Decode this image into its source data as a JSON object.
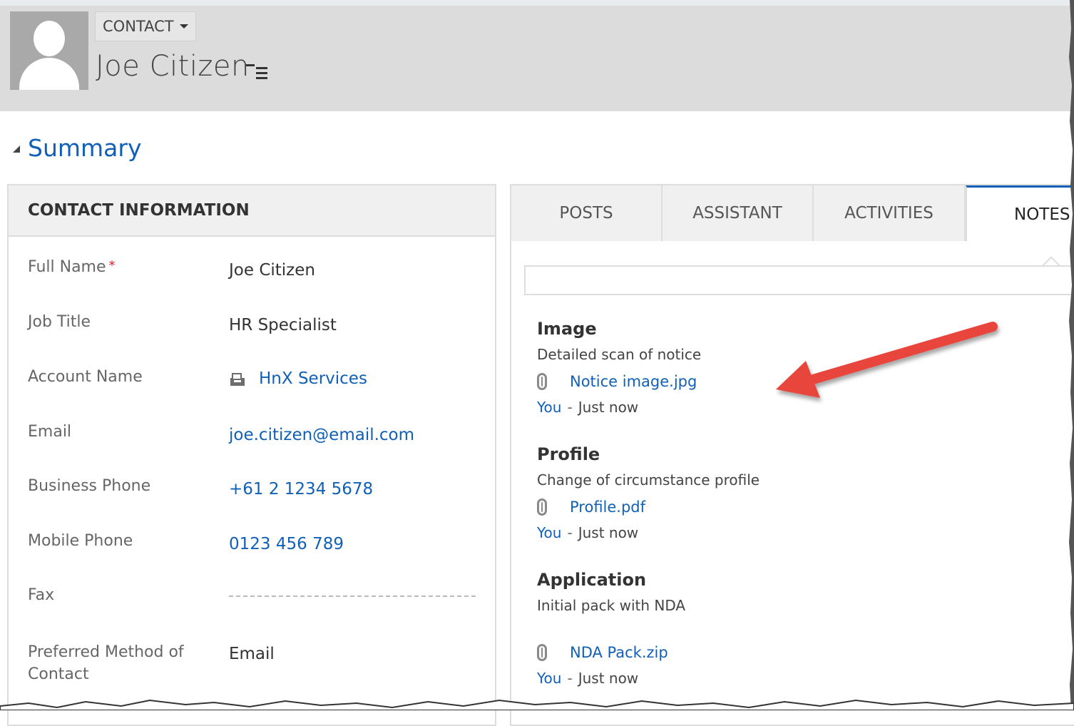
{
  "header": {
    "entity_label": "CONTACT",
    "record_name": "Joe Citizen"
  },
  "section": {
    "title": "Summary"
  },
  "contact_info": {
    "title": "CONTACT INFORMATION",
    "required_mark": "*",
    "fields": {
      "full_name": {
        "label": "Full Name",
        "value": "Joe Citizen"
      },
      "job_title": {
        "label": "Job Title",
        "value": "HR Specialist"
      },
      "account_name": {
        "label": "Account Name",
        "value": "HnX Services"
      },
      "email": {
        "label": "Email",
        "value": "joe.citizen@email.com"
      },
      "business_phone": {
        "label": "Business Phone",
        "value": "+61 2 1234 5678"
      },
      "mobile_phone": {
        "label": "Mobile Phone",
        "value": "0123 456 789"
      },
      "fax": {
        "label": "Fax",
        "value": ""
      },
      "preferred_contact": {
        "label": "Preferred Method of Contact",
        "value": "Email"
      }
    }
  },
  "tabs": [
    "POSTS",
    "ASSISTANT",
    "ACTIVITIES",
    "NOTES"
  ],
  "notes": [
    {
      "title": "Image",
      "description": "Detailed scan of notice",
      "attachment": "Notice image.jpg",
      "author": "You",
      "separator": "-",
      "time": "Just now"
    },
    {
      "title": "Profile",
      "description": "Change of circumstance profile",
      "attachment": "Profile.pdf",
      "author": "You",
      "separator": "-",
      "time": "Just now"
    },
    {
      "title": "Application",
      "description": "Initial pack with NDA",
      "attachment": "NDA Pack.zip",
      "author": "You",
      "separator": "-",
      "time": "Just now"
    }
  ],
  "colors": {
    "link": "#1160b7",
    "header_bg": "#dcdcdc",
    "annotation_arrow": "#e8453c",
    "required": "#e81123"
  }
}
